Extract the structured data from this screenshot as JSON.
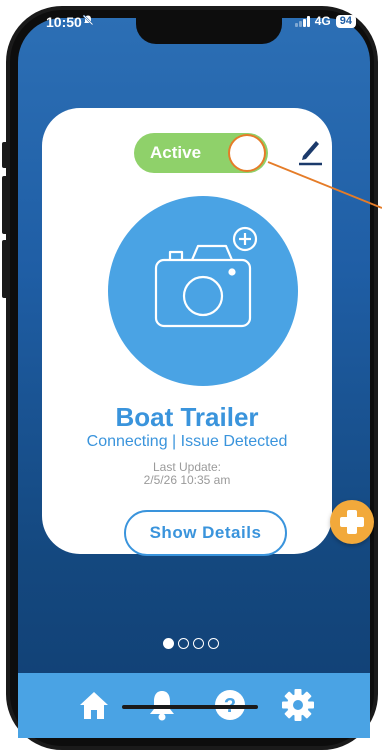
{
  "status_bar": {
    "time": "10:50",
    "network": "4G",
    "battery": "94"
  },
  "card": {
    "toggle_label": "Active",
    "device_name": "Boat Trailer",
    "device_status": "Connecting | Issue Detected",
    "last_update_label": "Last Update:",
    "last_update_value": "2/5/26 10:35 am",
    "show_details_label": "Show Details"
  },
  "pagination": {
    "total": 4,
    "current": 1
  },
  "nav": {
    "items": [
      "home-icon",
      "bell-icon",
      "help-icon",
      "gear-icon"
    ]
  },
  "colors": {
    "accent_blue": "#3a94dc",
    "toggle_green": "#8fd16a",
    "fab_orange": "#f2a93b",
    "callout_orange": "#e57c28"
  }
}
